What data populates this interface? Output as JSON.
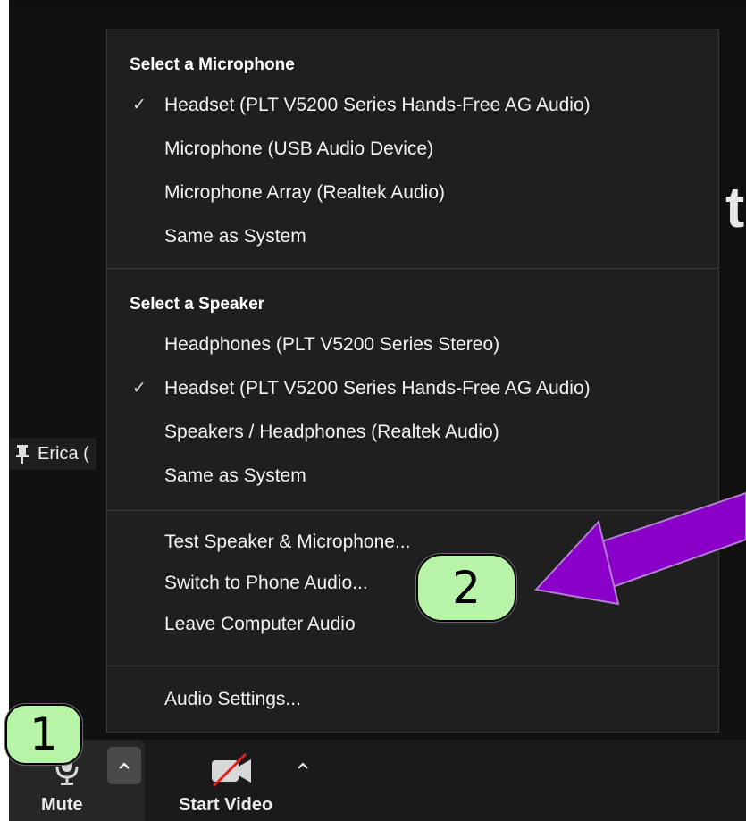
{
  "background": {
    "partial_text": "t",
    "participant_name": "Erica ("
  },
  "audio_menu": {
    "microphone": {
      "title": "Select a Microphone",
      "items": [
        {
          "label": "Headset (PLT V5200 Series Hands-Free AG Audio)",
          "checked": true
        },
        {
          "label": "Microphone (USB Audio Device)",
          "checked": false
        },
        {
          "label": "Microphone Array (Realtek Audio)",
          "checked": false
        },
        {
          "label": "Same as System",
          "checked": false
        }
      ]
    },
    "speaker": {
      "title": "Select a Speaker",
      "items": [
        {
          "label": "Headphones (PLT V5200 Series Stereo)",
          "checked": false
        },
        {
          "label": "Headset (PLT V5200 Series Hands-Free AG Audio)",
          "checked": true
        },
        {
          "label": "Speakers / Headphones (Realtek Audio)",
          "checked": false
        },
        {
          "label": "Same as System",
          "checked": false
        }
      ]
    },
    "actions": [
      {
        "label": "Test Speaker & Microphone..."
      },
      {
        "label": "Switch to Phone Audio..."
      },
      {
        "label": "Leave Computer Audio"
      }
    ],
    "settings_label": "Audio Settings...",
    "check_mark": "✓"
  },
  "toolbar": {
    "mute_label": "Mute",
    "video_label": "Start Video"
  },
  "annotations": {
    "badge_1": "1",
    "badge_2": "2",
    "badge_color": "#b8f4a8",
    "arrow_color": "#8b00c8"
  }
}
